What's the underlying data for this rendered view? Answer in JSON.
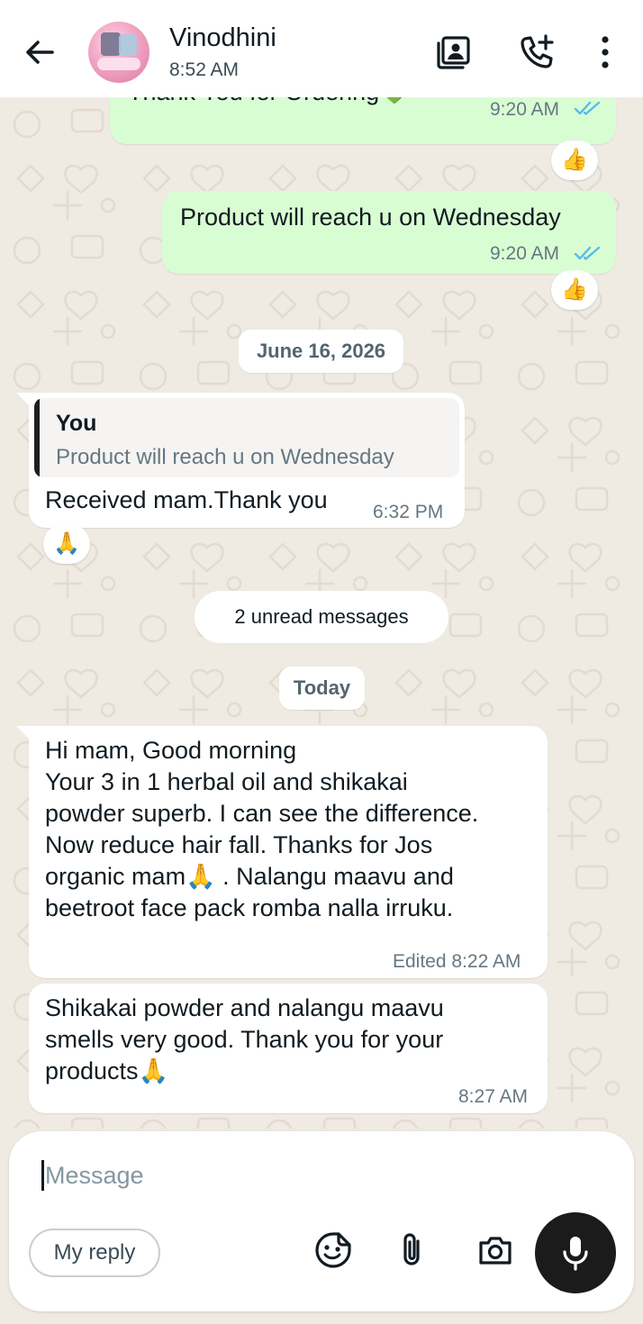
{
  "header": {
    "contact_name": "Vinodhini",
    "status": "8:52 AM"
  },
  "messages": {
    "m1": {
      "text": "Thank You for Ordering💚",
      "time": "9:20 AM",
      "reaction": "👍"
    },
    "m2": {
      "text": "Product will reach u on Wednesday",
      "time": "9:20 AM",
      "reaction": "👍"
    },
    "date1": "June 16, 2026",
    "m3": {
      "quote_author": "You",
      "quote_text": "Product will reach u on Wednesday",
      "text": "Received mam.Thank you",
      "time": "6:32 PM",
      "reaction": "🙏"
    },
    "unread": "2 unread messages",
    "date2": "Today",
    "m4": {
      "text": "Hi mam, Good morning\nYour 3 in 1 herbal oil and shikakai\npowder  superb. I can see the difference.\nNow reduce hair fall. Thanks for Jos\norganic mam🙏 . Nalangu maavu and\nbeetroot face pack   romba nalla irruku.",
      "time": "Edited 8:22 AM"
    },
    "m5": {
      "text": "Shikakai powder and  nalangu maavu\nsmells very good. Thank you for your\nproducts🙏",
      "time": "8:27 AM"
    }
  },
  "composer": {
    "placeholder": "Message",
    "reply_chip": "My reply"
  },
  "colors": {
    "outgoing_bubble": "#d9fdd3",
    "incoming_bubble": "#ffffff",
    "chat_background": "#efeae2",
    "read_ticks": "#53bdeb"
  }
}
